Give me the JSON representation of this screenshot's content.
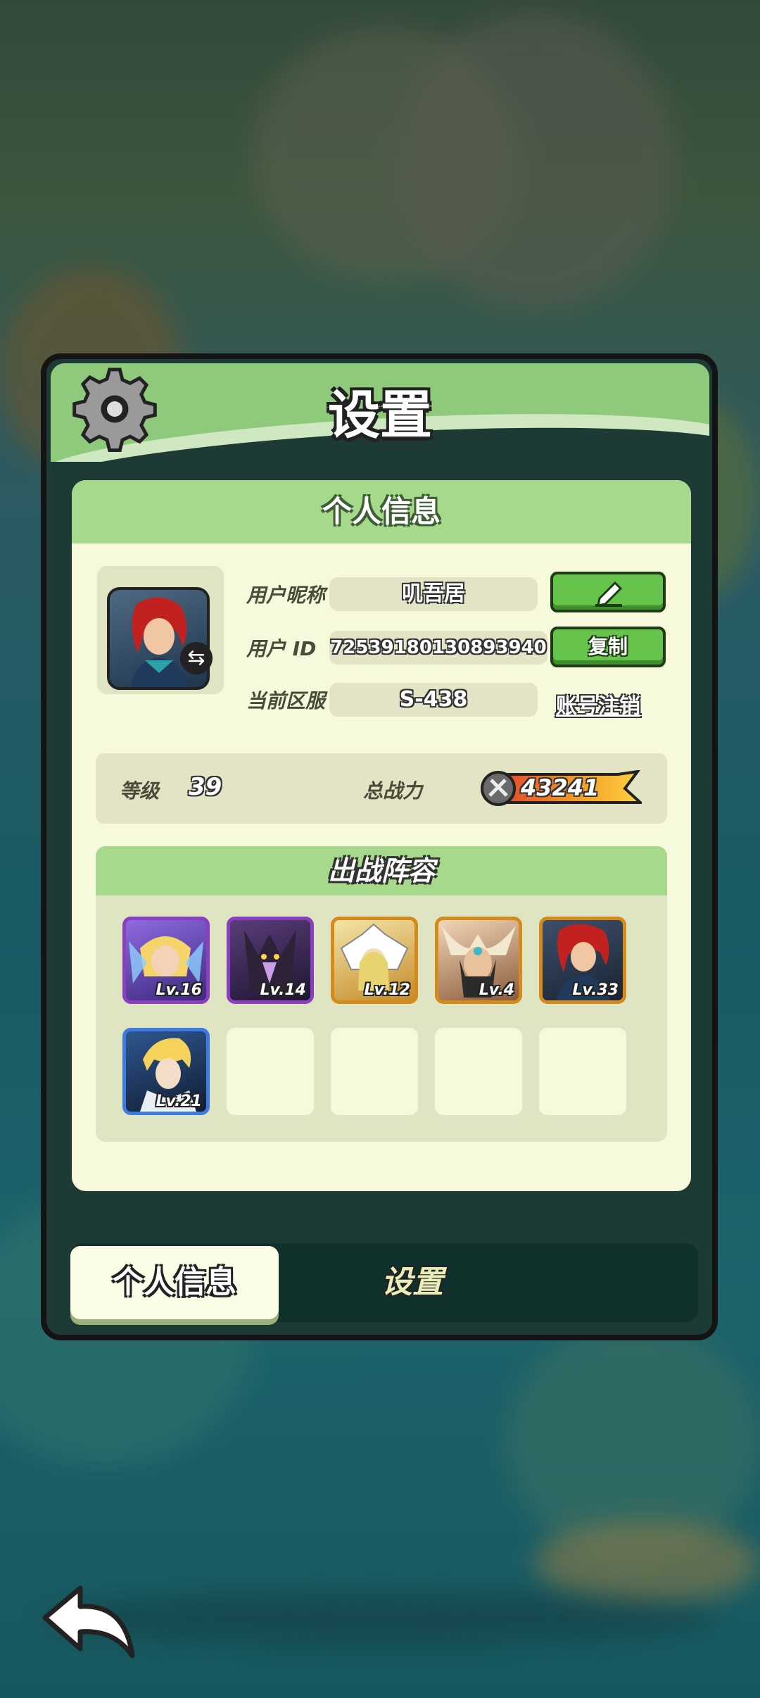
{
  "panel": {
    "title": "设置",
    "section_title": "个人信息",
    "profile": {
      "nickname_label": "用户昵称",
      "nickname": "叽吾居",
      "id_label": "用户  ID",
      "user_id": "72539180130893940",
      "server_label": "当前区服",
      "server": "S-438",
      "edit_icon": "pencil-icon",
      "copy_label": "复制",
      "delete_account_label": "账号注销"
    },
    "stats": {
      "level_label": "等级",
      "level": "39",
      "power_label": "总战力",
      "power": "43241"
    },
    "lineup": {
      "title": "出战阵容",
      "heroes": [
        {
          "level": "Lv.16",
          "frame": "purple"
        },
        {
          "level": "Lv.14",
          "frame": "purple"
        },
        {
          "level": "Lv.12",
          "frame": "gold"
        },
        {
          "level": "Lv.4",
          "frame": "gold"
        },
        {
          "level": "Lv.33",
          "frame": "gold"
        },
        {
          "level": "Lv.21",
          "frame": "blue"
        }
      ],
      "empty_slots": 4
    },
    "tabs": {
      "profile": "个人信息",
      "settings": "设置"
    }
  },
  "colors": {
    "header_green": "#8fc97b",
    "card_bg": "#f6f9dc",
    "button_green": "#65c24a"
  }
}
